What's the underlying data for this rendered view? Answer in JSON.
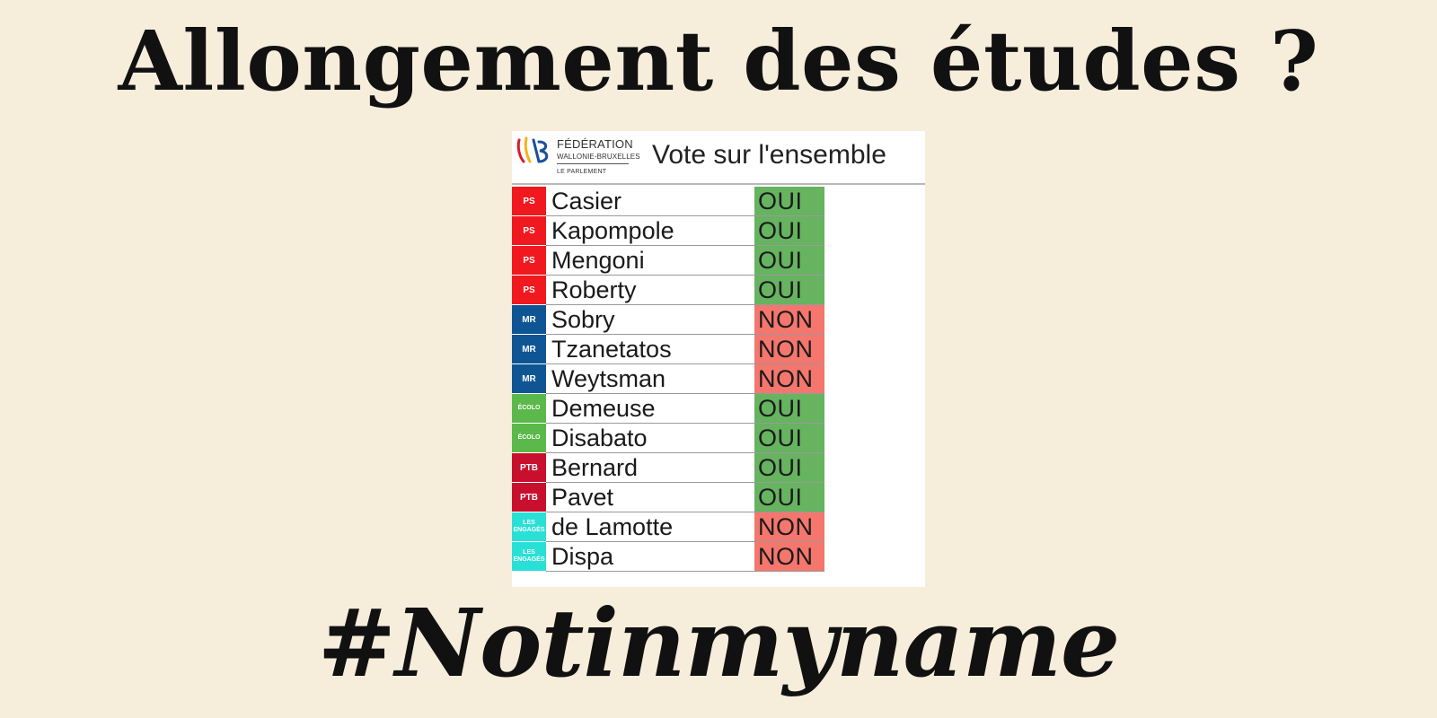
{
  "headline": "Allongement des études ?",
  "hashtag": "#Notinmyname",
  "panel": {
    "org_name": "FÉDÉRATION",
    "org_sub": "WALLONIE-BRUXELLES",
    "org_parl": "LE PARLEMENT",
    "title": "Vote sur l'ensemble"
  },
  "colors": {
    "background": "#f6eddb",
    "oui": "#66b360",
    "non": "#f4766d",
    "PS": "#f0191f",
    "MR": "#0f5594",
    "ECOLO": "#5bb84a",
    "PTB": "#c8102e",
    "ENGAGES": "#29e0d6"
  },
  "votes": [
    {
      "party": "PS",
      "party_key": "PS",
      "name": "Casier",
      "vote": "OUI"
    },
    {
      "party": "PS",
      "party_key": "PS",
      "name": "Kapompole",
      "vote": "OUI"
    },
    {
      "party": "PS",
      "party_key": "PS",
      "name": "Mengoni",
      "vote": "OUI"
    },
    {
      "party": "PS",
      "party_key": "PS",
      "name": "Roberty",
      "vote": "OUI"
    },
    {
      "party": "MR",
      "party_key": "MR",
      "name": "Sobry",
      "vote": "NON"
    },
    {
      "party": "MR",
      "party_key": "MR",
      "name": "Tzanetatos",
      "vote": "NON"
    },
    {
      "party": "MR",
      "party_key": "MR",
      "name": "Weytsman",
      "vote": "NON"
    },
    {
      "party": "ÉCOLO",
      "party_key": "ECOLO",
      "name": "Demeuse",
      "vote": "OUI"
    },
    {
      "party": "ÉCOLO",
      "party_key": "ECOLO",
      "name": "Disabato",
      "vote": "OUI"
    },
    {
      "party": "PTB",
      "party_key": "PTB",
      "name": "Bernard",
      "vote": "OUI"
    },
    {
      "party": "PTB",
      "party_key": "PTB",
      "name": "Pavet",
      "vote": "OUI"
    },
    {
      "party": "LES\nENGAGÉS",
      "party_key": "ENGAGES",
      "name": "de Lamotte",
      "vote": "NON"
    },
    {
      "party": "LES\nENGAGÉS",
      "party_key": "ENGAGES",
      "name": "Dispa",
      "vote": "NON"
    }
  ]
}
